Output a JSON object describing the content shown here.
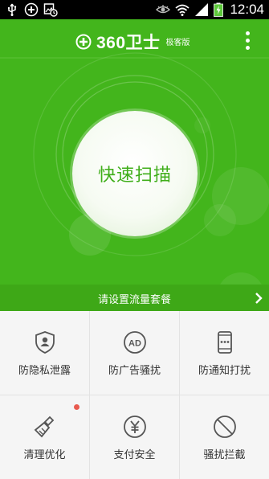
{
  "status_bar": {
    "time": "12:04",
    "icons": [
      "usb-icon",
      "add-circle-icon",
      "image-clock-icon",
      "eye-icon",
      "wifi-icon",
      "signal-icon",
      "battery-charging-icon"
    ]
  },
  "header": {
    "brand": "360卫士",
    "edition": "极客版",
    "menu_icon": "more-vert-icon"
  },
  "scan": {
    "label": "快速扫描"
  },
  "plan_banner": {
    "text": "请设置流量套餐",
    "icon": "chevron-right-icon"
  },
  "features": [
    {
      "label": "防隐私泄露",
      "icon": "shield-user-icon",
      "badge": false
    },
    {
      "label": "防广告骚扰",
      "icon": "ad-icon",
      "badge": false
    },
    {
      "label": "防通知打扰",
      "icon": "phone-notification-icon",
      "badge": false
    },
    {
      "label": "清理优化",
      "icon": "broom-icon",
      "badge": true
    },
    {
      "label": "支付安全",
      "icon": "yuan-icon",
      "badge": false
    },
    {
      "label": "骚扰拦截",
      "icon": "block-icon",
      "badge": false
    }
  ],
  "colors": {
    "primary_green": "#43b51c",
    "banner_green": "#3ea817",
    "badge_red": "#e85a4f",
    "icon_gray": "#555555"
  }
}
